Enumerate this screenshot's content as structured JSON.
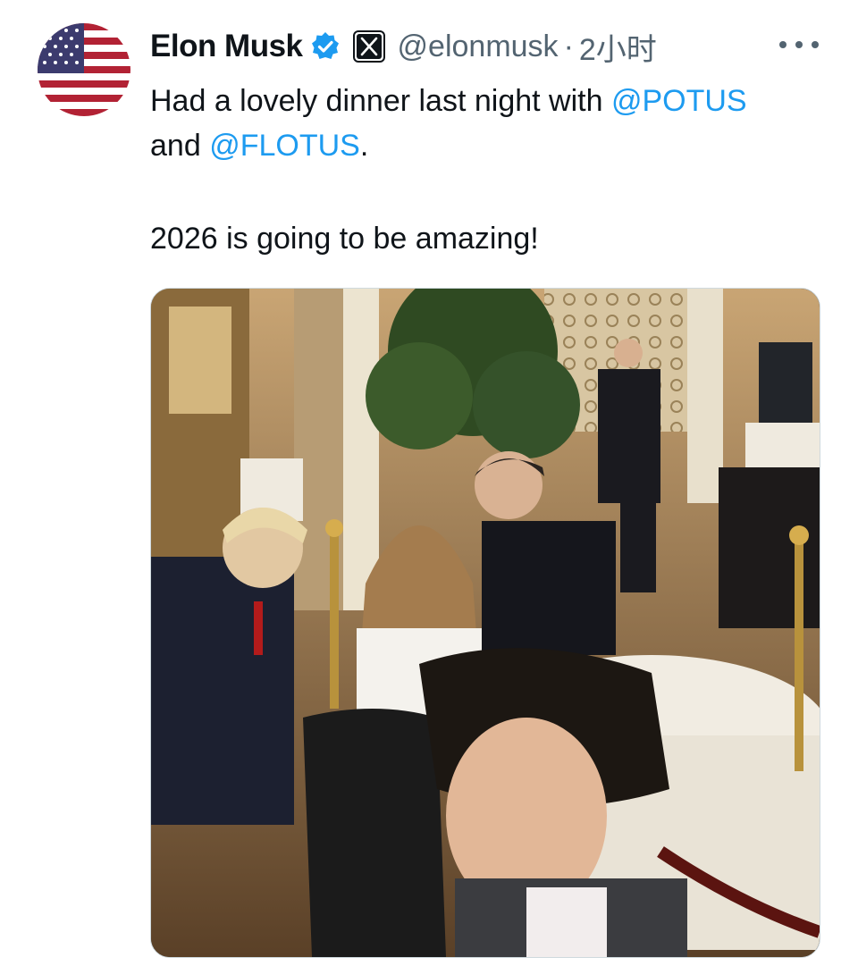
{
  "avatar": {
    "icon": "us-flag-icon"
  },
  "author": {
    "name": "Elon Musk",
    "verified_icon": "verified-badge-icon",
    "affiliation_icon": "x-logo-icon",
    "handle": "@elonmusk",
    "separator": "·",
    "time": "2小时"
  },
  "menu": {
    "icon": "more-options-icon"
  },
  "tweet": {
    "line1_text": "Had a lovely dinner last night with ",
    "mention1": "@POTUS",
    "line2_text": "and ",
    "mention2": "@FLOTUS",
    "line2_end": ".",
    "paragraph2": "2026 is going to be amazing!"
  },
  "media": {
    "type": "photo"
  },
  "colors": {
    "link": "#1d9bf0",
    "secondary_text": "#536471",
    "verified": "#1d9bf0"
  }
}
